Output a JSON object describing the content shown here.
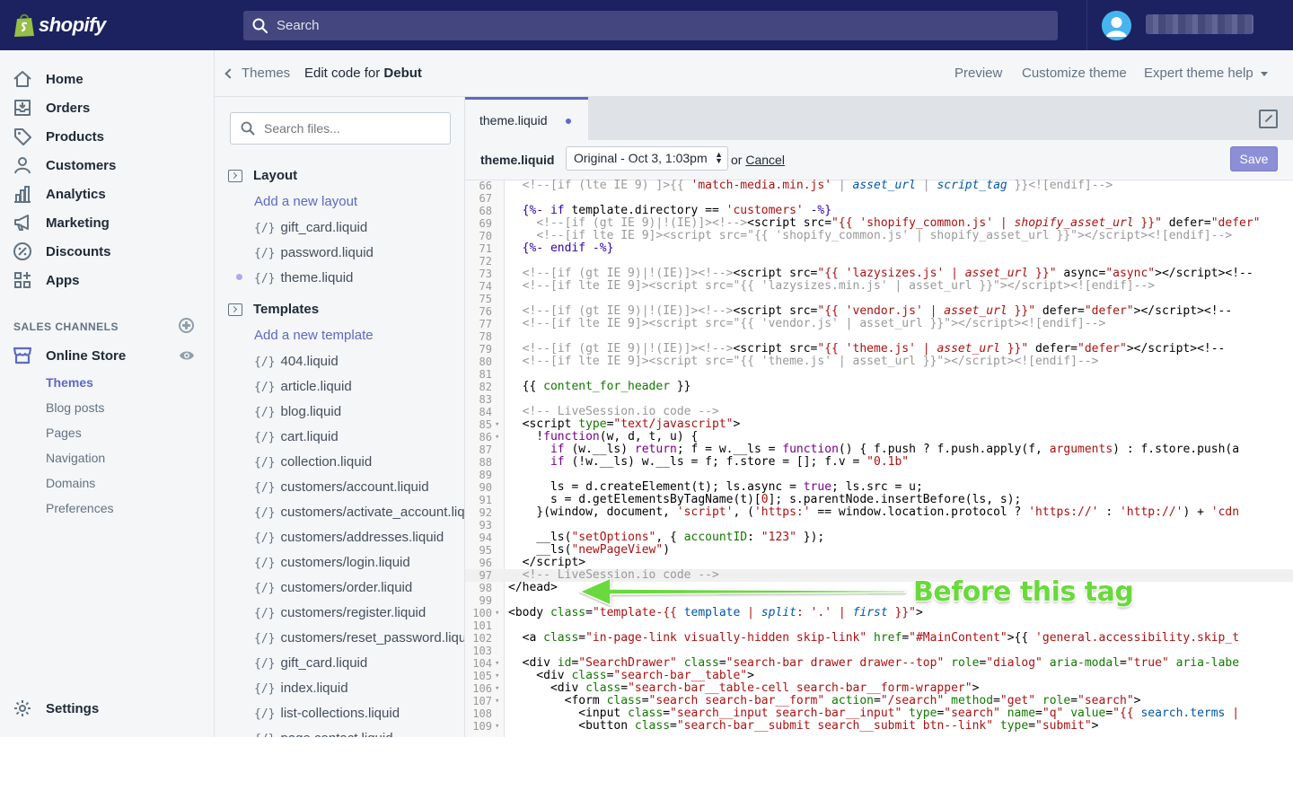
{
  "app": {
    "logo_text": "shopify",
    "search_placeholder": "Search",
    "brand_color": "#1c2260",
    "accent_color": "#5c6ac4"
  },
  "sidebar": {
    "items": [
      {
        "label": "Home",
        "icon": "home-icon"
      },
      {
        "label": "Orders",
        "icon": "orders-icon"
      },
      {
        "label": "Products",
        "icon": "tag-icon"
      },
      {
        "label": "Customers",
        "icon": "person-icon"
      },
      {
        "label": "Analytics",
        "icon": "bar-chart-icon"
      },
      {
        "label": "Marketing",
        "icon": "megaphone-icon"
      },
      {
        "label": "Discounts",
        "icon": "discount-icon"
      },
      {
        "label": "Apps",
        "icon": "apps-icon"
      }
    ],
    "sales_channels_title": "SALES CHANNELS",
    "online_store": "Online Store",
    "online_store_sub": [
      "Themes",
      "Blog posts",
      "Pages",
      "Navigation",
      "Domains",
      "Preferences"
    ],
    "active_sub": "Themes",
    "settings": "Settings"
  },
  "header": {
    "back_label": "Themes",
    "title_prefix": "Edit code for ",
    "theme_name": "Debut",
    "preview": "Preview",
    "customize": "Customize theme",
    "expert_help": "Expert theme help"
  },
  "files": {
    "search_placeholder": "Search files...",
    "layout_title": "Layout",
    "add_layout": "Add a new layout",
    "layout_files": [
      "gift_card.liquid",
      "password.liquid",
      "theme.liquid"
    ],
    "templates_title": "Templates",
    "add_template": "Add a new template",
    "template_files": [
      "404.liquid",
      "article.liquid",
      "blog.liquid",
      "cart.liquid",
      "collection.liquid",
      "customers/account.liquid",
      "customers/activate_account.liqu",
      "customers/addresses.liquid",
      "customers/login.liquid",
      "customers/order.liquid",
      "customers/register.liquid",
      "customers/reset_password.liqu",
      "gift_card.liquid",
      "index.liquid",
      "list-collections.liquid",
      "page.contact.liquid"
    ]
  },
  "editor": {
    "tab_label": "theme.liquid",
    "file_label": "theme.liquid",
    "version": "Original - Oct 3, 1:03pm",
    "or_text": "or",
    "cancel": "Cancel",
    "save": "Save"
  },
  "annotation": {
    "text": "Before this tag"
  }
}
